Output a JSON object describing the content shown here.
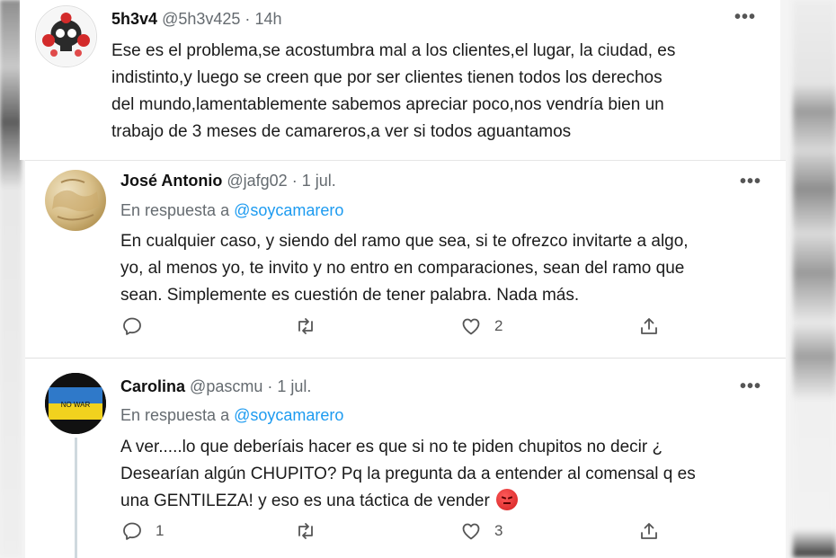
{
  "tweets": [
    {
      "name": "5h3v4",
      "handle": "@5h3v425",
      "time": "14h",
      "lines": [
        "Ese es el problema,se acostumbra mal a los clientes,el lugar, la ciudad, es",
        "indistinto,y luego se creen que por  ser clientes tienen todos los derechos",
        "del mundo,lamentablemente sabemos apreciar poco,nos vendría bien un",
        "trabajo de 3 meses de camareros,a ver si todos aguantamos"
      ]
    },
    {
      "name": "José Antonio",
      "handle": "@jafg02",
      "time": "1 jul.",
      "replying_prefix": "En respuesta a",
      "replying_to": "@soycamarero",
      "lines": [
        "En cualquier caso, y siendo del ramo que sea, si te ofrezco invitarte a algo,",
        "yo, al menos yo, te invito y no entro en comparaciones, sean del ramo que",
        "sean. Simplemente es cuestión de tener palabra. Nada más."
      ],
      "reply_count": "",
      "retweet_count": "",
      "like_count": "2"
    },
    {
      "name": "Carolina",
      "handle": "@pascmu",
      "time": "1 jul.",
      "replying_prefix": "En respuesta a",
      "replying_to": "@soycamarero",
      "lines": [
        "A ver.....lo que deberíais hacer es que si no te piden chupitos no decir ¿",
        "Desearían algún CHUPITO? Pq la pregunta da a entender al comensal q es",
        "una GENTILEZA! y eso es una táctica de vender"
      ],
      "reply_count": "1",
      "retweet_count": "",
      "like_count": "3",
      "avatar_text": "NO WAR"
    }
  ],
  "ui": {
    "separator": "·",
    "more": "•••"
  },
  "icons": [
    "reply-icon",
    "retweet-icon",
    "like-icon",
    "share-icon",
    "more-icon",
    "angry-face-emoji"
  ],
  "colors": {
    "link": "#1d9bf0",
    "secondary": "#656b70",
    "text": "#1b1b1b"
  }
}
